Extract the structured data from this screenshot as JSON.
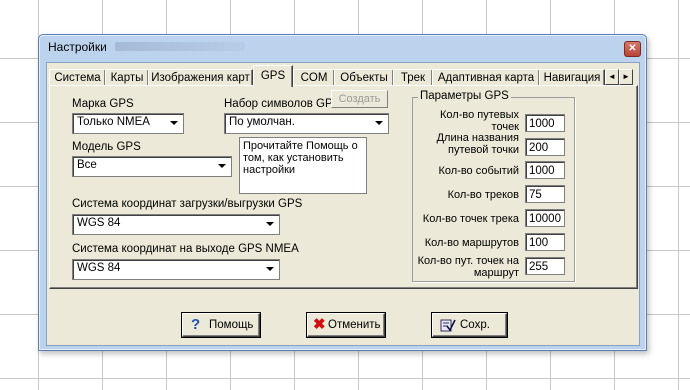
{
  "window": {
    "title": "Настройки",
    "close_glyph": "✕"
  },
  "tabs": [
    "Система",
    "Карты",
    "Изображения карт",
    "GPS",
    "COM",
    "Объекты",
    "Трек",
    "Адаптивная карта",
    "Навигация"
  ],
  "active_tab": "GPS",
  "tab_scroll": {
    "left": "◄",
    "right": "►"
  },
  "gps": {
    "brand_label": "Марка GPS",
    "brand_value": "Только NMEA",
    "charset_label": "Набор символов GPS",
    "charset_value": "По умолчан.",
    "create_button": "Создать",
    "model_label": "Модель GPS",
    "model_value": "Все",
    "hint_text": "Прочитайте Помощь о том, как установить настройки",
    "coord_io_label": "Система координат загрузки/выгрузки GPS",
    "coord_io_value": "WGS 84",
    "coord_nmea_label": "Система координат на выходе GPS NMEA",
    "coord_nmea_value": "WGS 84"
  },
  "params": {
    "title": "Параметры GPS",
    "fields": [
      {
        "label": "Кол-во путевых точек",
        "value": "1000"
      },
      {
        "label": "Длина названия путевой точки",
        "value": "200"
      },
      {
        "label": "Кол-во событий",
        "value": "1000"
      },
      {
        "label": "Кол-во треков",
        "value": "75"
      },
      {
        "label": "Кол-во точек трека",
        "value": "10000"
      },
      {
        "label": "Кол-во маршрутов",
        "value": "100"
      },
      {
        "label": "Кол-во пут. точек на маршрут",
        "value": "255"
      }
    ]
  },
  "buttons": {
    "help": "Помощь",
    "cancel": "Отменить",
    "save": "Сохр."
  },
  "colors": {
    "help_icon": "#1f4fb4",
    "cancel_icon": "#d01010",
    "save_icon": "#303060"
  }
}
